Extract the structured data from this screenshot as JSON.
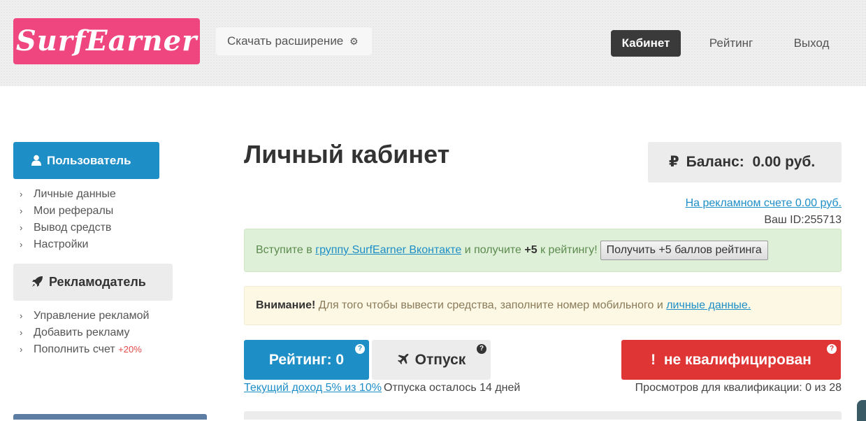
{
  "header": {
    "logo": "SurfEarner",
    "download_label": "Скачать расширение",
    "nav": {
      "cabinet": "Кабинет",
      "rating": "Рейтинг",
      "exit": "Выход"
    }
  },
  "sidebar": {
    "user_button": "Пользователь",
    "user_items": [
      "Личные данные",
      "Мои рефералы",
      "Вывод средств",
      "Настройки"
    ],
    "advertiser_button": "Рекламодатель",
    "advertiser_items": [
      "Управление рекламой",
      "Добавить рекламу",
      "Пополнить счет"
    ],
    "topup_bonus": "+20%"
  },
  "main": {
    "title": "Личный кабинет",
    "balance_label": "Баланс:",
    "balance_value": "0.00 руб.",
    "ad_account": "На рекламном счете 0.00 руб.",
    "user_id": "Ваш ID:255713",
    "green_alert": {
      "prefix": "Вступите в",
      "link": "группу SurfEarner Вконтакте",
      "middle": "и получите",
      "bold": "+5",
      "suffix": "к рейтингу!",
      "button": "Получить +5 баллов рейтинга"
    },
    "yellow_alert": {
      "bold": "Внимание!",
      "text": "Для того чтобы вывести средства, заполните номер мобильного и",
      "link": "личные данные."
    },
    "rating_button": "Рейтинг: 0",
    "vacation_button": "Отпуск",
    "qual_button": "не квалифицирован",
    "qual_mark": "!",
    "help_mark": "?",
    "income_link": "Текущий доход 5% из 10%",
    "vacation_left": "Отпуска осталось 14 дней",
    "views_qual": "Просмотров для квалификации: 0 из 28"
  },
  "colors": {
    "brand_pink": "#f0467f",
    "primary_blue": "#1e8ec7",
    "danger_red": "#e03535",
    "dark_nav": "#3a3a3a"
  }
}
